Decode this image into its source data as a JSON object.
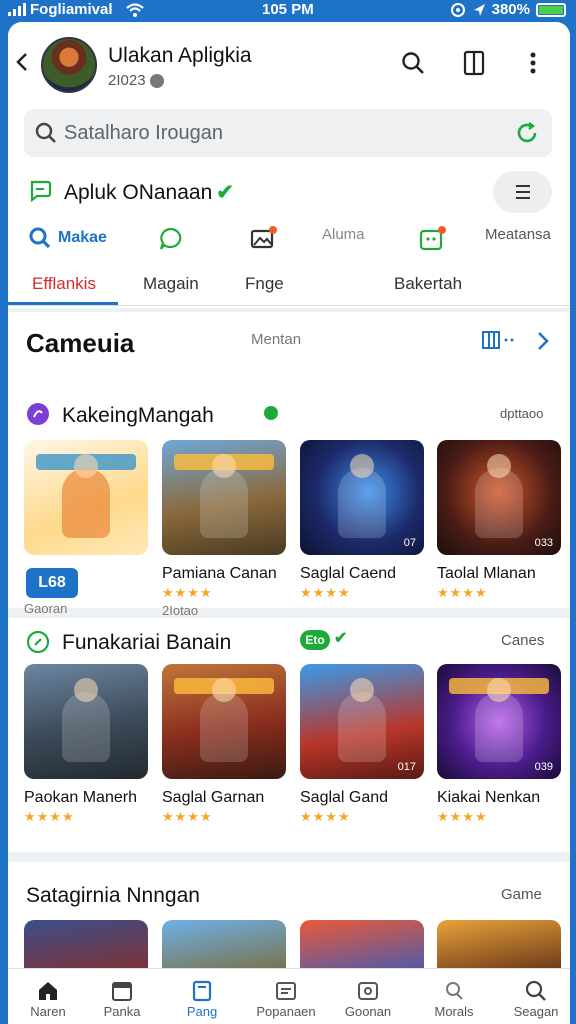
{
  "status_bar": {
    "carrier": "Fogliamival",
    "time": "105 PM",
    "battery": "380%"
  },
  "header": {
    "title": "Ulakan Apligkia",
    "subtitle": "2I023"
  },
  "search": {
    "placeholder": "Satalharo Irougan"
  },
  "brand": {
    "title": "Apluk ONanaan"
  },
  "actions": [
    {
      "label": "Makae",
      "icon": "search-icon"
    },
    {
      "label": "",
      "icon": "chat-icon"
    },
    {
      "label": "",
      "icon": "image-icon"
    },
    {
      "label": "Aluma",
      "icon": ""
    },
    {
      "label": "",
      "icon": "store-icon"
    },
    {
      "label": "Meatansa",
      "icon": ""
    }
  ],
  "tabs": [
    {
      "label": "Efflankis",
      "active": true
    },
    {
      "label": "Magain",
      "active": false
    },
    {
      "label": "Fnge",
      "active": false
    },
    {
      "label": "Bakertah",
      "active": false
    }
  ],
  "section1": {
    "title": "Cameuia",
    "more": "Mentan",
    "sub_title": "KakeingMangah",
    "sub_more": "dpttaoo",
    "games": [
      {
        "name": "",
        "sub": "Gaoran",
        "stars": "",
        "price": "L68",
        "thumb_label": ""
      },
      {
        "name": "Pamiana Canan",
        "sub": "2Iotao",
        "stars": "★★★★",
        "thumb_label": ""
      },
      {
        "name": "Saglal Caend",
        "sub": "",
        "stars": "★★★★",
        "thumb_label": "07"
      },
      {
        "name": "Taolal Mlanan",
        "sub": "",
        "stars": "★★★★",
        "thumb_label": "033"
      }
    ]
  },
  "section2": {
    "title": "Funakariai Banain",
    "badge": "Eto",
    "more": "Canes",
    "games": [
      {
        "name": "Paokan Manerh",
        "stars": "★★★★",
        "thumb_label": ""
      },
      {
        "name": "Saglal Garnan",
        "stars": "★★★★",
        "thumb_label": ""
      },
      {
        "name": "Saglal Gand",
        "stars": "★★★★",
        "thumb_label": "017"
      },
      {
        "name": "Kiakai Nenkan",
        "stars": "★★★★",
        "thumb_label": "039"
      }
    ]
  },
  "section3": {
    "title": "Satagirnia Nnngan",
    "more": "Game"
  },
  "bottom_nav": [
    {
      "label": "Naren",
      "icon": "home-icon",
      "active": false
    },
    {
      "label": "Panka",
      "icon": "calendar-icon",
      "active": false
    },
    {
      "label": "Pang",
      "icon": "bookmark-icon",
      "active": true
    },
    {
      "label": "Popanaen",
      "icon": "list-icon",
      "active": false
    },
    {
      "label": "Goonan",
      "icon": "gamepad-icon",
      "active": false
    },
    {
      "label": "Morals",
      "icon": "profile-icon",
      "active": false
    },
    {
      "label": "Seagan",
      "icon": "search-icon",
      "active": false
    }
  ],
  "colors": {
    "accent": "#1e73c8",
    "active_tab": "#d62b2b",
    "success": "#1eaa38",
    "star": "#f5a623"
  }
}
